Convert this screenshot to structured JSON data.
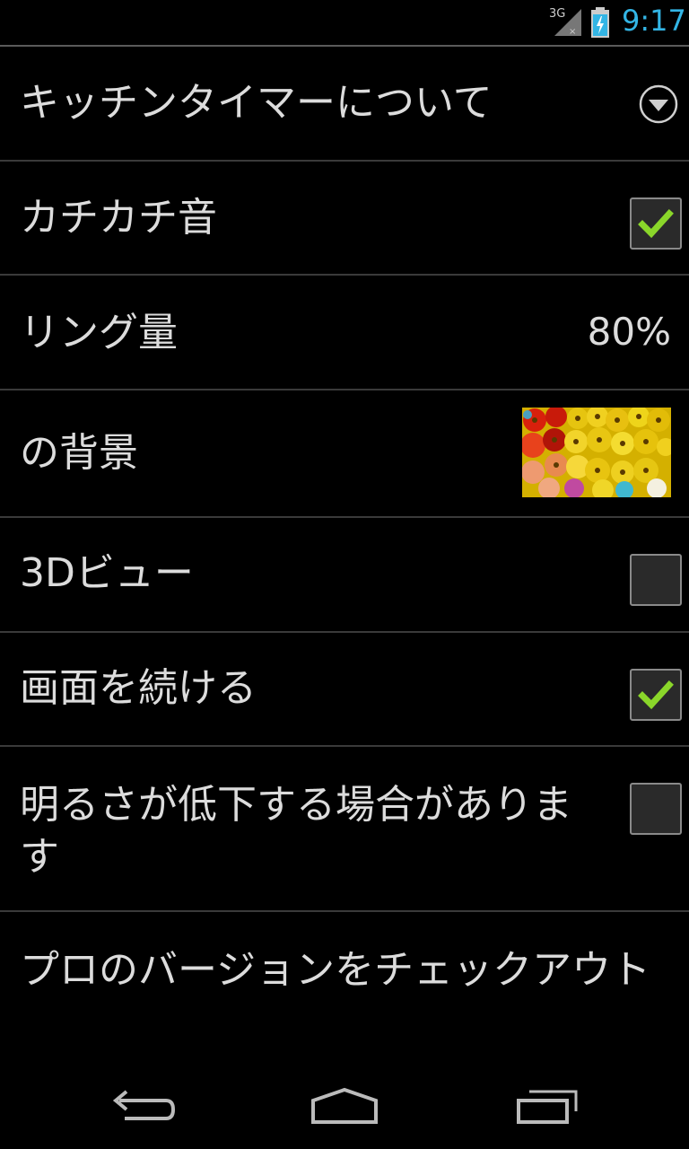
{
  "status_bar": {
    "network": "3G",
    "time": "9:17",
    "accent_color": "#33b5e5"
  },
  "settings": {
    "about": {
      "label": "キッチンタイマーについて",
      "icon": "chevron-down-circle-icon"
    },
    "tick_sound": {
      "label": "カチカチ音",
      "checked": true
    },
    "ring_volume": {
      "label": "リング量",
      "value": "80%"
    },
    "background": {
      "label": "の背景",
      "thumbnail": "flowers-image"
    },
    "view_3d": {
      "label": "3Dビュー",
      "checked": false
    },
    "keep_screen_on": {
      "label": "画面を続ける",
      "checked": true
    },
    "dim_warning": {
      "label": "明るさが低下する場合があります",
      "checked": false
    },
    "pro_version": {
      "label": "プロのバージョンをチェックアウト"
    }
  },
  "nav_bar": {
    "back": "back-icon",
    "home": "home-icon",
    "recents": "recent-apps-icon"
  },
  "colors": {
    "check": "#8ad62a"
  }
}
